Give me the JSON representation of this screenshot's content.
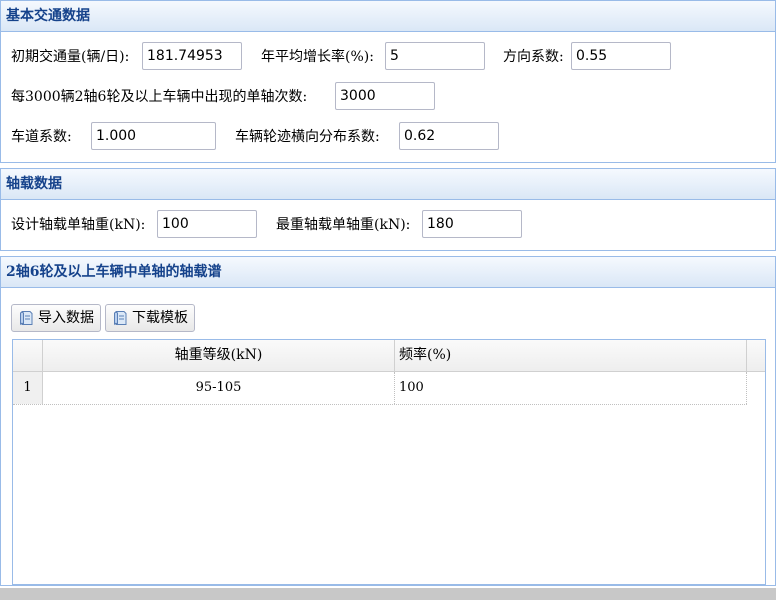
{
  "basic_panel": {
    "title": "基本交通数据",
    "initial_volume": {
      "label": "初期交通量(辆/日):",
      "value": "181.74953"
    },
    "annual_growth": {
      "label": "年平均增长率(%):",
      "value": "5"
    },
    "direction_coef": {
      "label": "方向系数:",
      "value": "0.55"
    },
    "single_axle_count": {
      "label": "每3000辆2轴6轮及以上车辆中出现的单轴次数:",
      "value": "3000"
    },
    "lane_coef": {
      "label": "车道系数:",
      "value": "1.000"
    },
    "wheel_track_coef": {
      "label": "车辆轮迹横向分布系数:",
      "value": "0.62"
    }
  },
  "axle_panel": {
    "title": "轴载数据",
    "design_load": {
      "label": "设计轴载单轴重(kN):",
      "value": "100"
    },
    "max_load": {
      "label": "最重轴载单轴重(kN):",
      "value": "180"
    }
  },
  "spectrum_panel": {
    "title": "2轴6轮及以上车辆中单轴的轴载谱",
    "import_button": "导入数据",
    "download_button": "下载模板",
    "columns": [
      "轴重等级(kN)",
      "频率(%)"
    ],
    "rows": [
      {
        "index": "1",
        "level": "95-105",
        "frequency": "100"
      }
    ]
  }
}
